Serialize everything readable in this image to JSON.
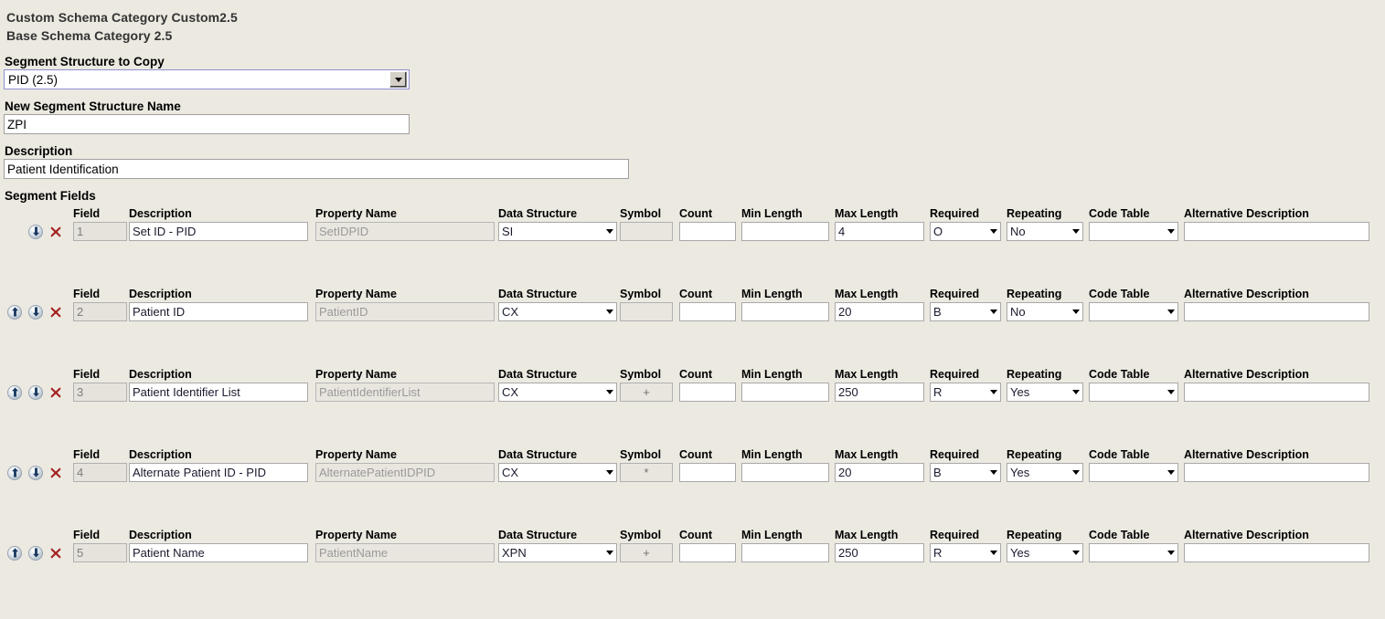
{
  "header": {
    "custom_category": "Custom Schema Category Custom2.5",
    "base_category": "Base Schema Category 2.5"
  },
  "form": {
    "segment_structure_to_copy_label": "Segment Structure to Copy",
    "segment_structure_to_copy_value": "PID (2.5)",
    "new_segment_structure_name_label": "New Segment Structure Name",
    "new_segment_structure_name_value": "ZPI",
    "description_label": "Description",
    "description_value": "Patient Identification",
    "segment_fields_label": "Segment Fields"
  },
  "columns": {
    "field": "Field",
    "description": "Description",
    "property_name": "Property Name",
    "data_structure": "Data Structure",
    "symbol": "Symbol",
    "count": "Count",
    "min_length": "Min Length",
    "max_length": "Max Length",
    "required": "Required",
    "repeating": "Repeating",
    "code_table": "Code Table",
    "alternative_description": "Alternative Description"
  },
  "rows": [
    {
      "field": "1",
      "description": "Set ID - PID",
      "property_name": "SetIDPID",
      "data_structure": "SI",
      "symbol": "",
      "count": "",
      "min_length": "",
      "max_length": "4",
      "required": "O",
      "repeating": "No",
      "code_table": "",
      "alternative_description": "",
      "has_up": false,
      "has_down": true
    },
    {
      "field": "2",
      "description": "Patient ID",
      "property_name": "PatientID",
      "data_structure": "CX",
      "symbol": "",
      "count": "",
      "min_length": "",
      "max_length": "20",
      "required": "B",
      "repeating": "No",
      "code_table": "",
      "alternative_description": "",
      "has_up": true,
      "has_down": true
    },
    {
      "field": "3",
      "description": "Patient Identifier List",
      "property_name": "PatientIdentifierList",
      "data_structure": "CX",
      "symbol": "+",
      "count": "",
      "min_length": "",
      "max_length": "250",
      "required": "R",
      "repeating": "Yes",
      "code_table": "",
      "alternative_description": "",
      "has_up": true,
      "has_down": true
    },
    {
      "field": "4",
      "description": "Alternate Patient ID - PID",
      "property_name": "AlternatePatientIDPID",
      "data_structure": "CX",
      "symbol": "*",
      "count": "",
      "min_length": "",
      "max_length": "20",
      "required": "B",
      "repeating": "Yes",
      "code_table": "",
      "alternative_description": "",
      "has_up": true,
      "has_down": true
    },
    {
      "field": "5",
      "description": "Patient Name",
      "property_name": "PatientName",
      "data_structure": "XPN",
      "symbol": "+",
      "count": "",
      "min_length": "",
      "max_length": "250",
      "required": "R",
      "repeating": "Yes",
      "code_table": "",
      "alternative_description": "",
      "has_up": true,
      "has_down": true
    }
  ],
  "icons": {
    "move_up": "arrow-up-icon",
    "move_down": "arrow-down-icon",
    "delete": "delete-x-icon",
    "dropdown": "chevron-down-icon"
  },
  "colors": {
    "page_background": "#ece9e1",
    "delete_icon": "#a32020",
    "select_focus_border": "#8f8fd1",
    "arrow_icon": "#1c3a5e"
  }
}
